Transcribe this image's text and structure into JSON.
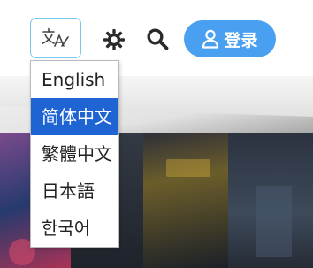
{
  "header": {
    "language_icon": "translate-icon",
    "theme_icon": "sun-gear-icon",
    "search_icon": "search-icon",
    "login_label": "登录",
    "login_icon": "user-icon"
  },
  "language_menu": {
    "items": [
      {
        "label": "English",
        "selected": false
      },
      {
        "label": "简体中文",
        "selected": true
      },
      {
        "label": "繁體中文",
        "selected": false
      },
      {
        "label": "日本語",
        "selected": false
      },
      {
        "label": "한국어",
        "selected": false
      }
    ]
  },
  "colors": {
    "accent": "#4aa0f0",
    "selected_bg": "#1e64d2",
    "language_button_border": "#79c7ec"
  }
}
